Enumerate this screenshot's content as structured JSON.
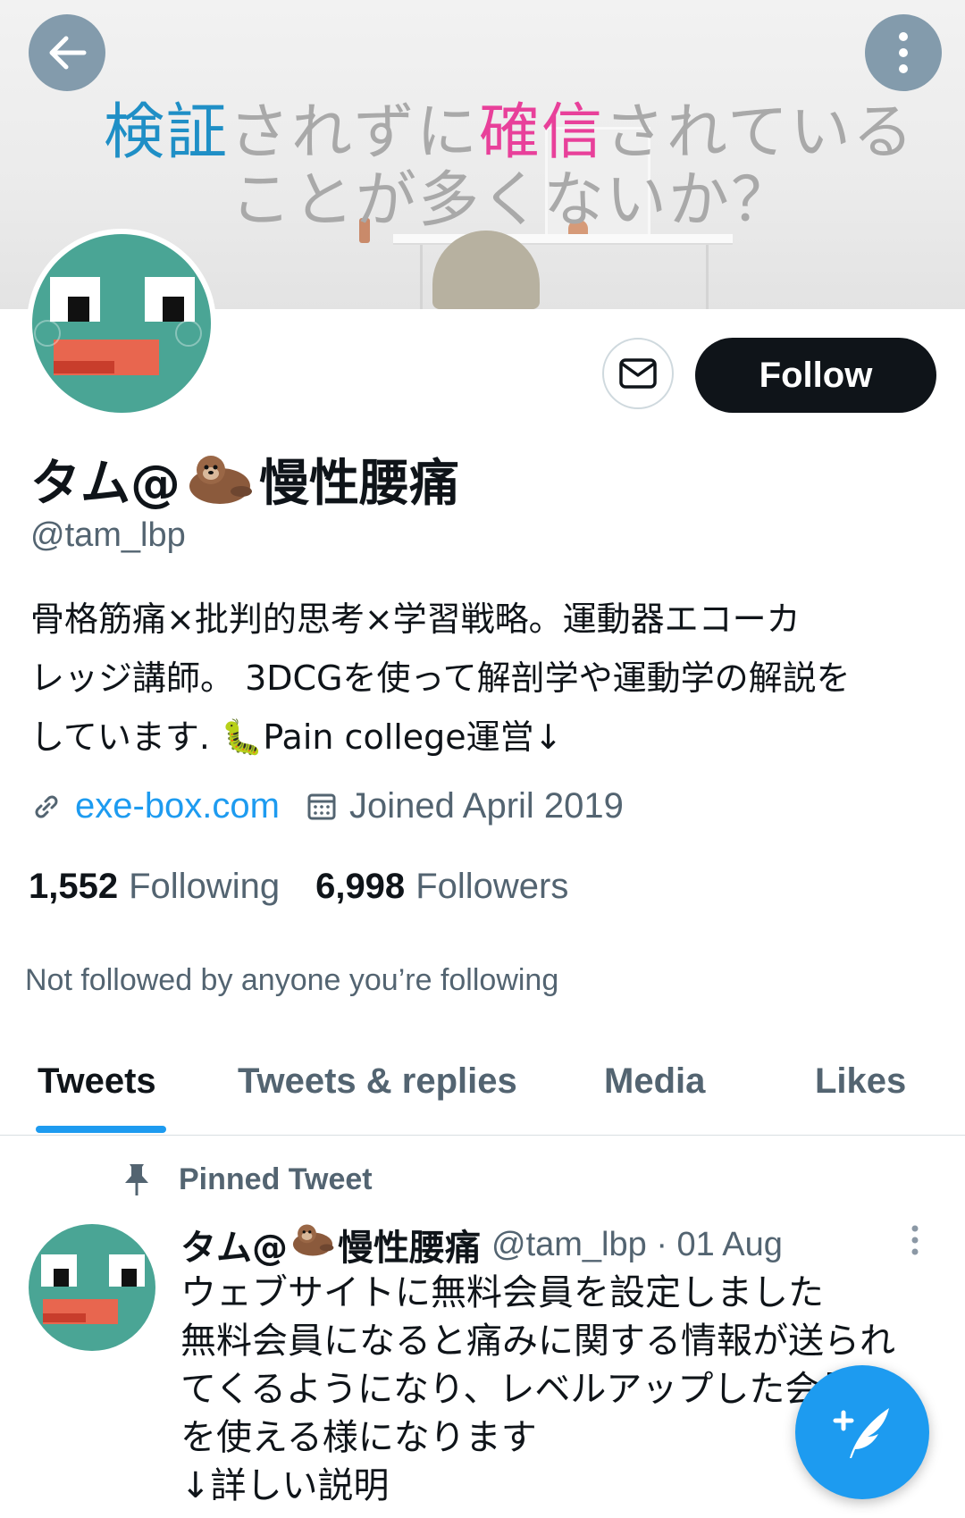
{
  "banner": {
    "line1": {
      "part1": "検証",
      "part2": "されずに",
      "part3": "確信",
      "part4": "されている"
    },
    "line2": "ことが多くないか？",
    "colors": {
      "blue": "#1f8fc6",
      "pink": "#e8409a"
    }
  },
  "nav": {
    "back_icon": "arrow-left-icon",
    "more_icon": "more-vertical-icon"
  },
  "profile": {
    "name_prefix": "タム@",
    "name_suffix": "慢性腰痛",
    "name_emoji": "otter-emoji",
    "handle": "@tam_lbp",
    "bio_lines": [
      "骨格筋痛×批判的思考×学習戦略。運動器エコーカ",
      "レッジ講師。 3DCGを使って解剖学や運動学の解説を",
      "しています. 🐛Pain college運営↓"
    ],
    "website": "exe-box.com",
    "joined": "Joined April 2019",
    "following_count": "1,552",
    "following_label": "Following",
    "followers_count": "6,998",
    "followers_label": "Followers",
    "not_followed": "Not followed by anyone you’re following"
  },
  "actions": {
    "message_icon": "envelope-icon",
    "follow_label": "Follow"
  },
  "tabs": [
    {
      "label": "Tweets",
      "active": true
    },
    {
      "label": "Tweets & replies",
      "active": false
    },
    {
      "label": "Media",
      "active": false
    },
    {
      "label": "Likes",
      "active": false
    }
  ],
  "pinned_tweet": {
    "pinned_label": "Pinned Tweet",
    "author_prefix": "タム@",
    "author_suffix": "慢性腰痛",
    "meta": "@tam_lbp · 01 Aug",
    "lines": [
      "ウェブサイトに無料会員を設定しました",
      "無料会員になると痛みに関する情報が送られ",
      "てくるようになり、レベルアップした会員",
      "を使える様になります",
      "↓詳しい説明"
    ]
  },
  "fab": {
    "icon": "compose-tweet-icon"
  },
  "colors": {
    "accent": "#1d9bf0",
    "text": "#0f1419",
    "muted": "#536471",
    "avatar_bg": "#4aa595"
  }
}
